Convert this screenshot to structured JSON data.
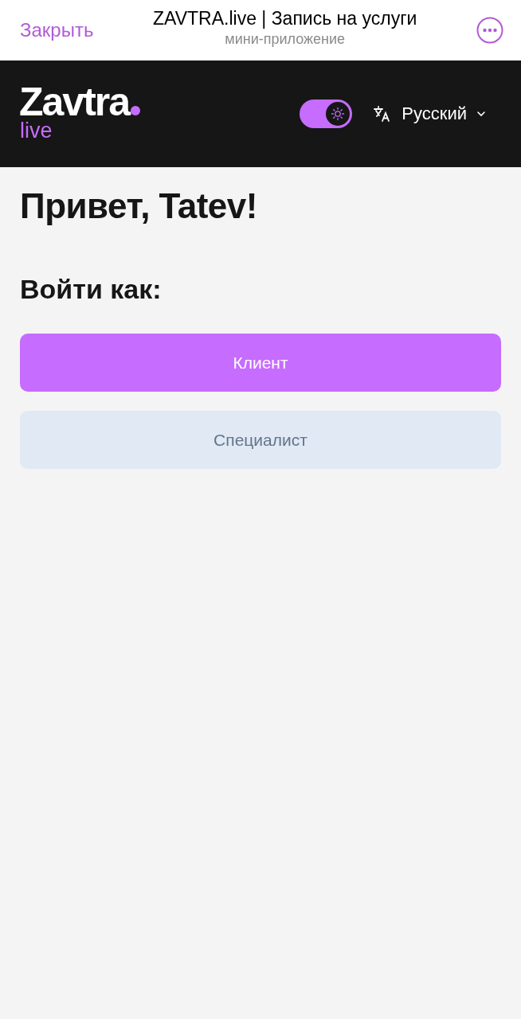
{
  "topbar": {
    "close": "Закрыть",
    "title": "ZAVTRA.live | Запись на услуги",
    "subtitle": "мини-приложение"
  },
  "header": {
    "logo": {
      "name": "Zavtra",
      "sub": "live"
    },
    "theme_toggle": {
      "on": true
    },
    "language": "Русский"
  },
  "greeting": "Привет, Tatev!",
  "login_prompt": "Войти как:",
  "buttons": [
    {
      "label": "Клиент",
      "kind": "primary"
    },
    {
      "label": "Специалист",
      "kind": "secondary"
    }
  ]
}
